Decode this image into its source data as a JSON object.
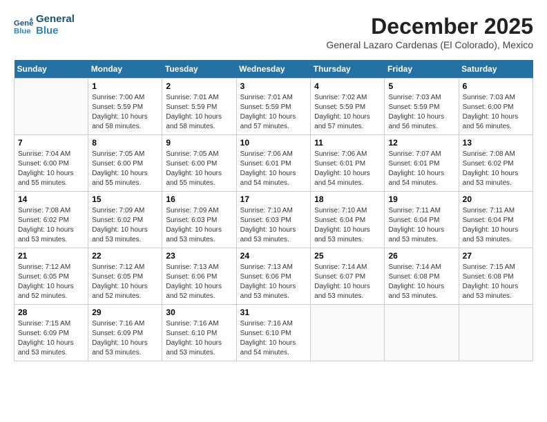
{
  "header": {
    "logo_line1": "General",
    "logo_line2": "Blue",
    "month": "December 2025",
    "location": "General Lazaro Cardenas (El Colorado), Mexico"
  },
  "weekdays": [
    "Sunday",
    "Monday",
    "Tuesday",
    "Wednesday",
    "Thursday",
    "Friday",
    "Saturday"
  ],
  "weeks": [
    [
      {
        "day": "",
        "sunrise": "",
        "sunset": "",
        "daylight": ""
      },
      {
        "day": "1",
        "sunrise": "Sunrise: 7:00 AM",
        "sunset": "Sunset: 5:59 PM",
        "daylight": "Daylight: 10 hours and 58 minutes."
      },
      {
        "day": "2",
        "sunrise": "Sunrise: 7:01 AM",
        "sunset": "Sunset: 5:59 PM",
        "daylight": "Daylight: 10 hours and 58 minutes."
      },
      {
        "day": "3",
        "sunrise": "Sunrise: 7:01 AM",
        "sunset": "Sunset: 5:59 PM",
        "daylight": "Daylight: 10 hours and 57 minutes."
      },
      {
        "day": "4",
        "sunrise": "Sunrise: 7:02 AM",
        "sunset": "Sunset: 5:59 PM",
        "daylight": "Daylight: 10 hours and 57 minutes."
      },
      {
        "day": "5",
        "sunrise": "Sunrise: 7:03 AM",
        "sunset": "Sunset: 5:59 PM",
        "daylight": "Daylight: 10 hours and 56 minutes."
      },
      {
        "day": "6",
        "sunrise": "Sunrise: 7:03 AM",
        "sunset": "Sunset: 6:00 PM",
        "daylight": "Daylight: 10 hours and 56 minutes."
      }
    ],
    [
      {
        "day": "7",
        "sunrise": "Sunrise: 7:04 AM",
        "sunset": "Sunset: 6:00 PM",
        "daylight": "Daylight: 10 hours and 55 minutes."
      },
      {
        "day": "8",
        "sunrise": "Sunrise: 7:05 AM",
        "sunset": "Sunset: 6:00 PM",
        "daylight": "Daylight: 10 hours and 55 minutes."
      },
      {
        "day": "9",
        "sunrise": "Sunrise: 7:05 AM",
        "sunset": "Sunset: 6:00 PM",
        "daylight": "Daylight: 10 hours and 55 minutes."
      },
      {
        "day": "10",
        "sunrise": "Sunrise: 7:06 AM",
        "sunset": "Sunset: 6:01 PM",
        "daylight": "Daylight: 10 hours and 54 minutes."
      },
      {
        "day": "11",
        "sunrise": "Sunrise: 7:06 AM",
        "sunset": "Sunset: 6:01 PM",
        "daylight": "Daylight: 10 hours and 54 minutes."
      },
      {
        "day": "12",
        "sunrise": "Sunrise: 7:07 AM",
        "sunset": "Sunset: 6:01 PM",
        "daylight": "Daylight: 10 hours and 54 minutes."
      },
      {
        "day": "13",
        "sunrise": "Sunrise: 7:08 AM",
        "sunset": "Sunset: 6:02 PM",
        "daylight": "Daylight: 10 hours and 53 minutes."
      }
    ],
    [
      {
        "day": "14",
        "sunrise": "Sunrise: 7:08 AM",
        "sunset": "Sunset: 6:02 PM",
        "daylight": "Daylight: 10 hours and 53 minutes."
      },
      {
        "day": "15",
        "sunrise": "Sunrise: 7:09 AM",
        "sunset": "Sunset: 6:02 PM",
        "daylight": "Daylight: 10 hours and 53 minutes."
      },
      {
        "day": "16",
        "sunrise": "Sunrise: 7:09 AM",
        "sunset": "Sunset: 6:03 PM",
        "daylight": "Daylight: 10 hours and 53 minutes."
      },
      {
        "day": "17",
        "sunrise": "Sunrise: 7:10 AM",
        "sunset": "Sunset: 6:03 PM",
        "daylight": "Daylight: 10 hours and 53 minutes."
      },
      {
        "day": "18",
        "sunrise": "Sunrise: 7:10 AM",
        "sunset": "Sunset: 6:04 PM",
        "daylight": "Daylight: 10 hours and 53 minutes."
      },
      {
        "day": "19",
        "sunrise": "Sunrise: 7:11 AM",
        "sunset": "Sunset: 6:04 PM",
        "daylight": "Daylight: 10 hours and 53 minutes."
      },
      {
        "day": "20",
        "sunrise": "Sunrise: 7:11 AM",
        "sunset": "Sunset: 6:04 PM",
        "daylight": "Daylight: 10 hours and 53 minutes."
      }
    ],
    [
      {
        "day": "21",
        "sunrise": "Sunrise: 7:12 AM",
        "sunset": "Sunset: 6:05 PM",
        "daylight": "Daylight: 10 hours and 52 minutes."
      },
      {
        "day": "22",
        "sunrise": "Sunrise: 7:12 AM",
        "sunset": "Sunset: 6:05 PM",
        "daylight": "Daylight: 10 hours and 52 minutes."
      },
      {
        "day": "23",
        "sunrise": "Sunrise: 7:13 AM",
        "sunset": "Sunset: 6:06 PM",
        "daylight": "Daylight: 10 hours and 52 minutes."
      },
      {
        "day": "24",
        "sunrise": "Sunrise: 7:13 AM",
        "sunset": "Sunset: 6:06 PM",
        "daylight": "Daylight: 10 hours and 53 minutes."
      },
      {
        "day": "25",
        "sunrise": "Sunrise: 7:14 AM",
        "sunset": "Sunset: 6:07 PM",
        "daylight": "Daylight: 10 hours and 53 minutes."
      },
      {
        "day": "26",
        "sunrise": "Sunrise: 7:14 AM",
        "sunset": "Sunset: 6:08 PM",
        "daylight": "Daylight: 10 hours and 53 minutes."
      },
      {
        "day": "27",
        "sunrise": "Sunrise: 7:15 AM",
        "sunset": "Sunset: 6:08 PM",
        "daylight": "Daylight: 10 hours and 53 minutes."
      }
    ],
    [
      {
        "day": "28",
        "sunrise": "Sunrise: 7:15 AM",
        "sunset": "Sunset: 6:09 PM",
        "daylight": "Daylight: 10 hours and 53 minutes."
      },
      {
        "day": "29",
        "sunrise": "Sunrise: 7:16 AM",
        "sunset": "Sunset: 6:09 PM",
        "daylight": "Daylight: 10 hours and 53 minutes."
      },
      {
        "day": "30",
        "sunrise": "Sunrise: 7:16 AM",
        "sunset": "Sunset: 6:10 PM",
        "daylight": "Daylight: 10 hours and 53 minutes."
      },
      {
        "day": "31",
        "sunrise": "Sunrise: 7:16 AM",
        "sunset": "Sunset: 6:10 PM",
        "daylight": "Daylight: 10 hours and 54 minutes."
      },
      {
        "day": "",
        "sunrise": "",
        "sunset": "",
        "daylight": ""
      },
      {
        "day": "",
        "sunrise": "",
        "sunset": "",
        "daylight": ""
      },
      {
        "day": "",
        "sunrise": "",
        "sunset": "",
        "daylight": ""
      }
    ]
  ]
}
